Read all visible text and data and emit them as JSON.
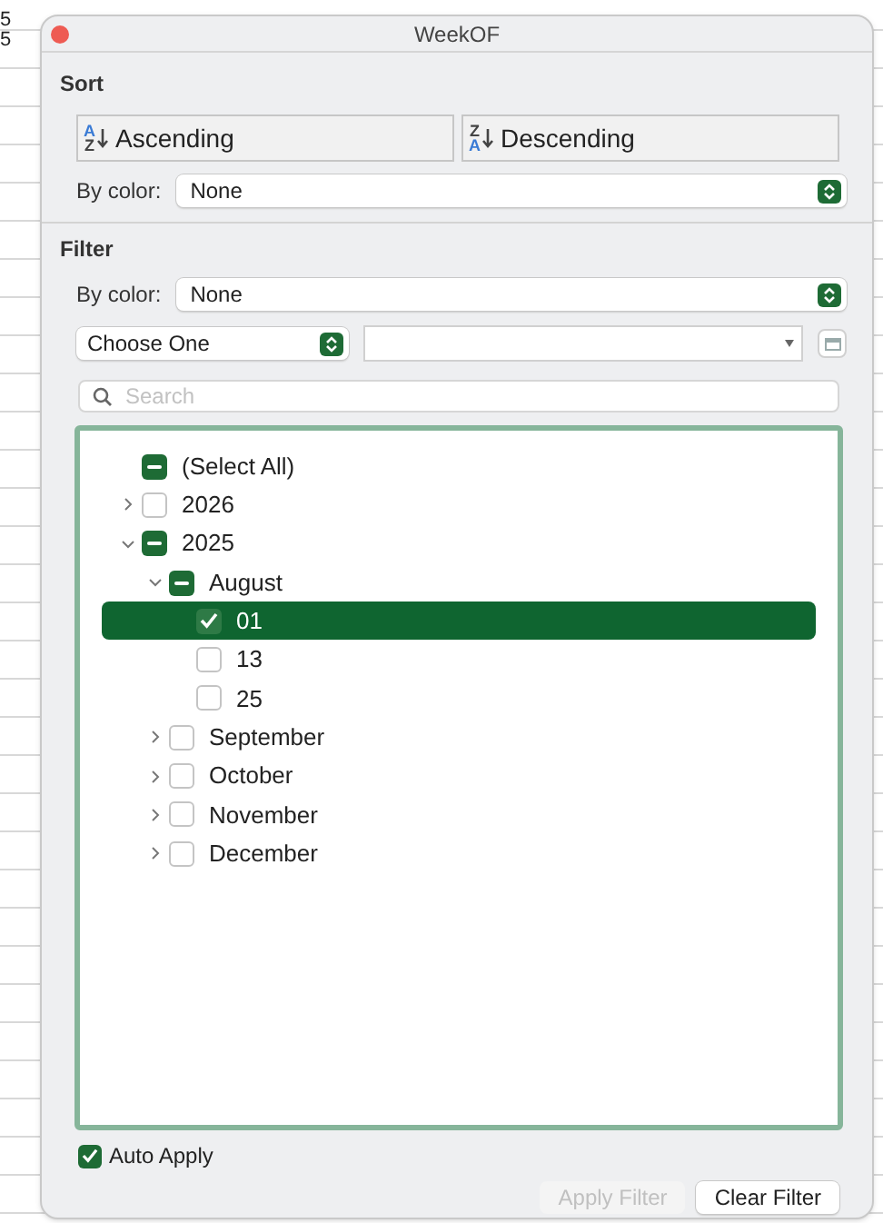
{
  "sheet_cells": [
    "5",
    "5"
  ],
  "window": {
    "title": "WeekOF"
  },
  "sort": {
    "heading": "Sort",
    "buttons": [
      {
        "kind": "ascending",
        "label": "Ascending",
        "top": "A",
        "bottom": "Z"
      },
      {
        "kind": "descending",
        "label": "Descending",
        "top": "Z",
        "bottom": "A"
      }
    ],
    "by_color_label": "By color:",
    "by_color_value": "None"
  },
  "filter": {
    "heading": "Filter",
    "by_color_label": "By color:",
    "by_color_value": "None",
    "condition": "Choose One",
    "search": {
      "placeholder": "Search"
    },
    "tree": [
      {
        "label": "(Select All)",
        "checked": true,
        "mixed": true,
        "selected": false
      },
      {
        "label": "2026",
        "checked": false,
        "mixed": false,
        "expanded": false,
        "selected": false
      },
      {
        "label": "2025",
        "checked": true,
        "mixed": true,
        "expanded": true,
        "selected": false,
        "children": [
          {
            "label": "August",
            "checked": true,
            "mixed": true,
            "expanded": true,
            "selected": false,
            "children": [
              {
                "label": "01",
                "checked": true,
                "mixed": false,
                "selected": true
              },
              {
                "label": "13",
                "checked": false,
                "mixed": false,
                "selected": false
              },
              {
                "label": "25",
                "checked": false,
                "mixed": false,
                "selected": false
              }
            ]
          },
          {
            "label": "September",
            "checked": false,
            "mixed": false,
            "expanded": false,
            "selected": false
          },
          {
            "label": "October",
            "checked": false,
            "mixed": false,
            "expanded": false,
            "selected": false
          },
          {
            "label": "November",
            "checked": false,
            "mixed": false,
            "expanded": false,
            "selected": false
          },
          {
            "label": "December",
            "checked": false,
            "mixed": false,
            "expanded": false,
            "selected": false
          }
        ]
      }
    ]
  },
  "auto_apply": {
    "label": "Auto Apply",
    "checked": true
  },
  "buttons": [
    {
      "label": "Apply Filter",
      "disabled": true
    },
    {
      "label": "Clear Filter",
      "disabled": false
    }
  ]
}
